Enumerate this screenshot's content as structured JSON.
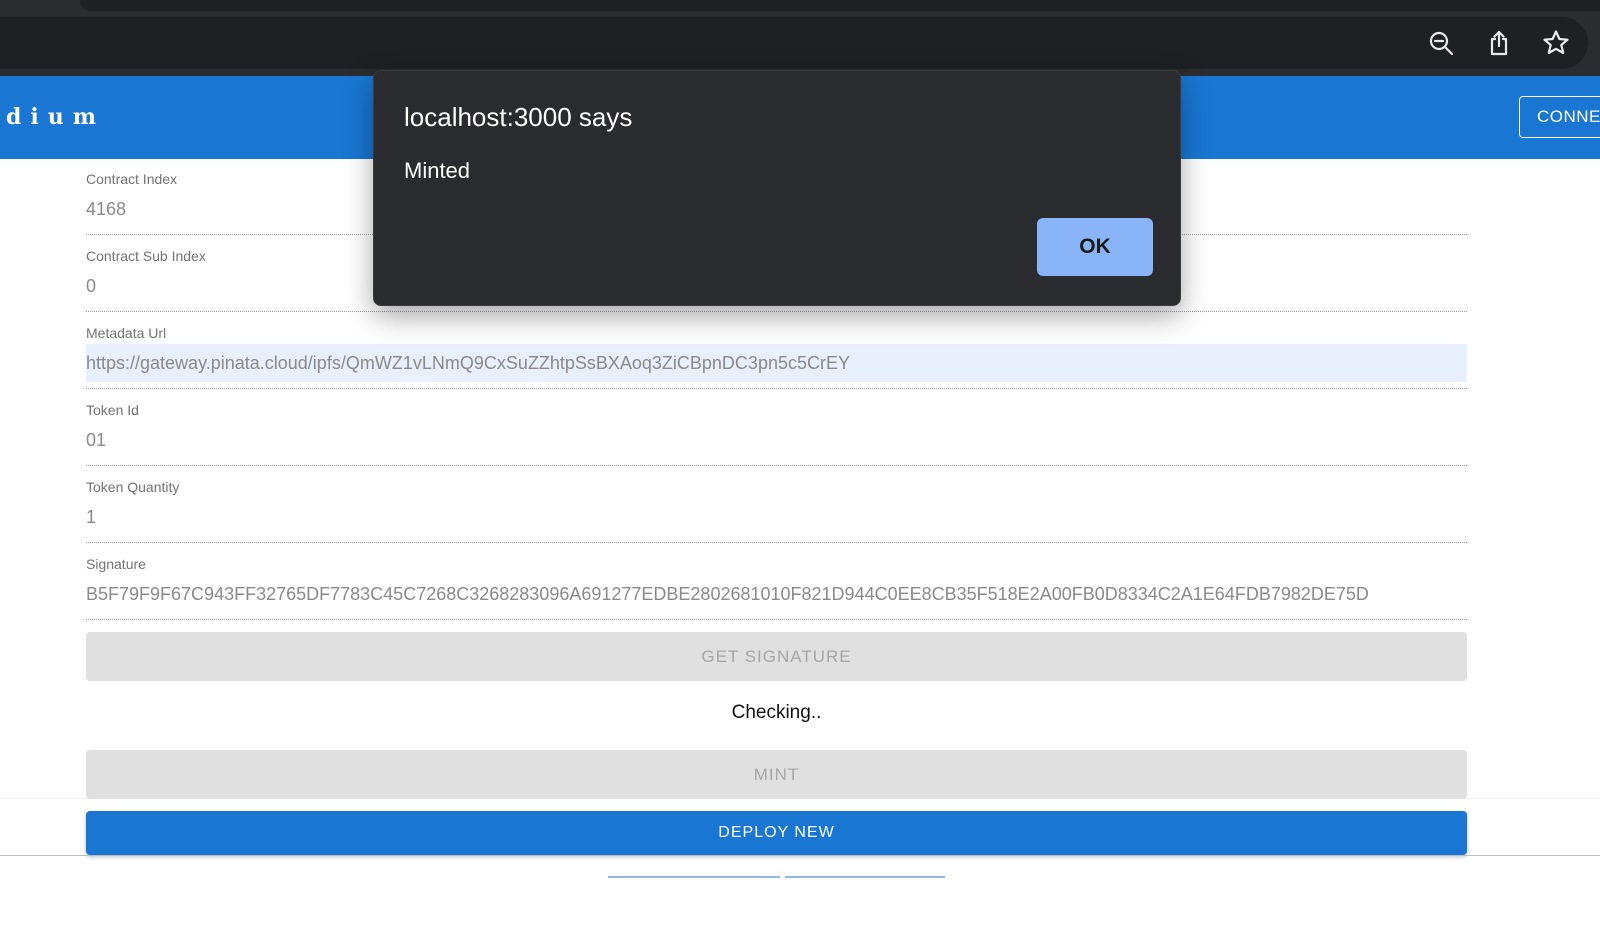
{
  "browser": {
    "icons": [
      "zoom-out-icon",
      "share-icon",
      "bookmark-star-icon"
    ]
  },
  "app": {
    "title": "dium",
    "connect_label": "CONNE",
    "brand_color": "#1976d2"
  },
  "form": {
    "fields": [
      {
        "label": "Contract Index",
        "value": "4168"
      },
      {
        "label": "Contract Sub Index",
        "value": "0"
      },
      {
        "label": "Metadata Url",
        "value": "https://gateway.pinata.cloud/ipfs/QmWZ1vLNmQ9CxSuZZhtpSsBXAoq3ZiCBpnDC3pn5c5CrEY"
      },
      {
        "label": "Token Id",
        "value": "01"
      },
      {
        "label": "Token Quantity",
        "value": "1"
      },
      {
        "label": "Signature",
        "value": "B5F79F9F67C943FF32765DF7783C45C7268C3268283096A691277EDBE2802681010F821D944C0EE8CB35F518E2A00FB0D8334C2A1E64FDB7982DE75D"
      }
    ],
    "get_signature_label": "GET SIGNATURE",
    "status_text": "Checking..",
    "mint_label": "MINT",
    "deploy_label": "DEPLOY NEW"
  },
  "dialog": {
    "title": "localhost:3000 says",
    "message": "Minted",
    "ok_label": "OK"
  }
}
